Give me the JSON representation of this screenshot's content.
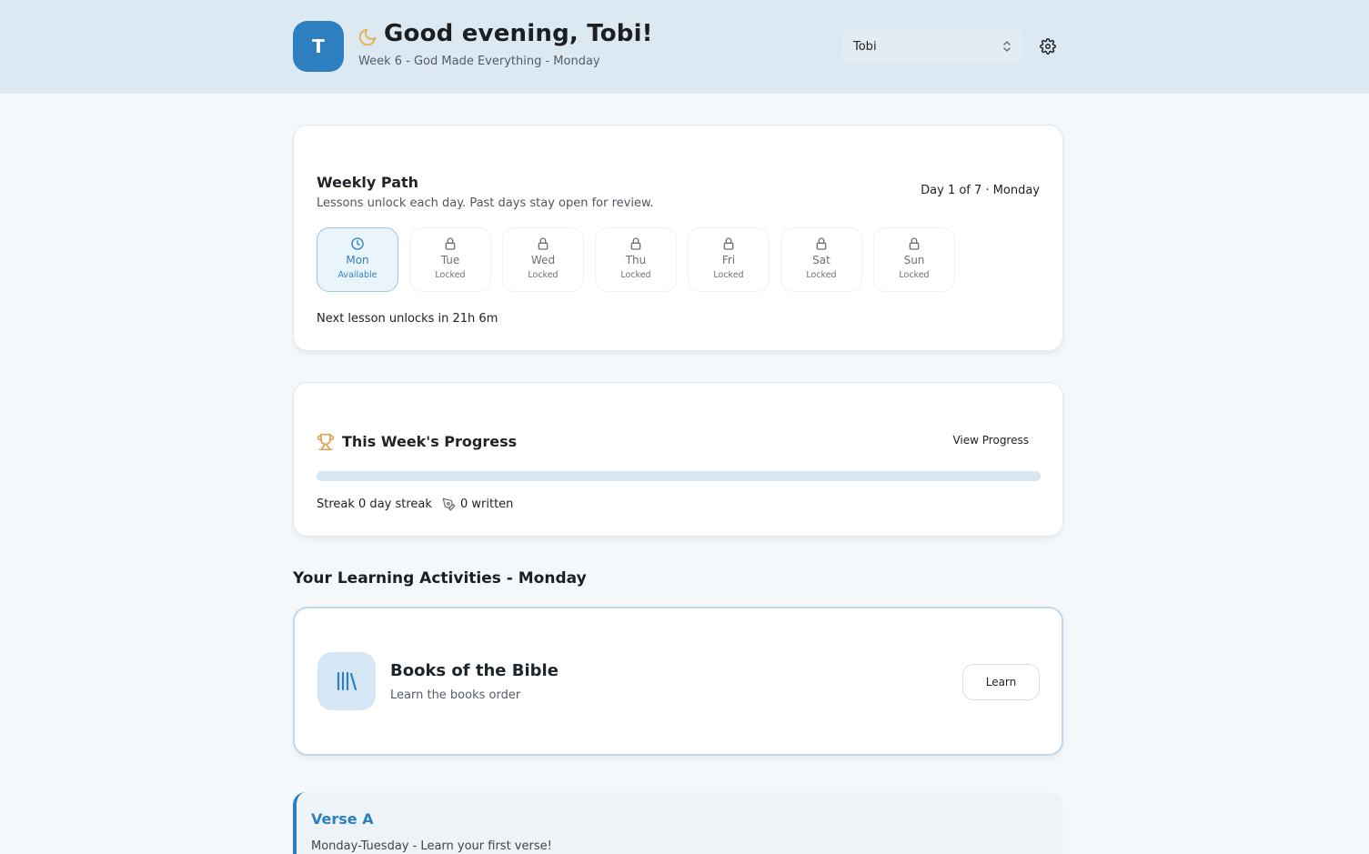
{
  "header": {
    "avatar_letter": "T",
    "greeting": "Good evening, Tobi!",
    "subtitle": "Week 6 - God Made Everything - Monday",
    "user_select_value": "Tobi"
  },
  "weekly_path": {
    "title": "Weekly Path",
    "description": "Lessons unlock each day. Past days stay open for review.",
    "day_indicator": "Day 1 of 7 · Monday",
    "days": [
      {
        "name": "Mon",
        "status": "Available",
        "icon": "clock-icon"
      },
      {
        "name": "Tue",
        "status": "Locked",
        "icon": "lock-icon"
      },
      {
        "name": "Wed",
        "status": "Locked",
        "icon": "lock-icon"
      },
      {
        "name": "Thu",
        "status": "Locked",
        "icon": "lock-icon"
      },
      {
        "name": "Fri",
        "status": "Locked",
        "icon": "lock-icon"
      },
      {
        "name": "Sat",
        "status": "Locked",
        "icon": "lock-icon"
      },
      {
        "name": "Sun",
        "status": "Locked",
        "icon": "lock-icon"
      }
    ],
    "next_unlock": "Next lesson unlocks in 21h 6m"
  },
  "progress": {
    "title": "This Week's Progress",
    "view_button": "View Progress",
    "percent": 0,
    "streak": "Streak 0 day streak",
    "written": "0 written"
  },
  "activities": {
    "section_title": "Your Learning Activities - Monday",
    "items": [
      {
        "title": "Books of the Bible",
        "description": "Learn the books order",
        "button": "Learn",
        "icon": "books-icon"
      }
    ]
  },
  "verse": {
    "title": "Verse A",
    "description": "Monday-Tuesday - Learn your first verse!"
  },
  "colors": {
    "accent": "#2e7fbf",
    "header_bg": "#dde9f2",
    "moon": "#e8b04a",
    "trophy": "#e0a050"
  }
}
